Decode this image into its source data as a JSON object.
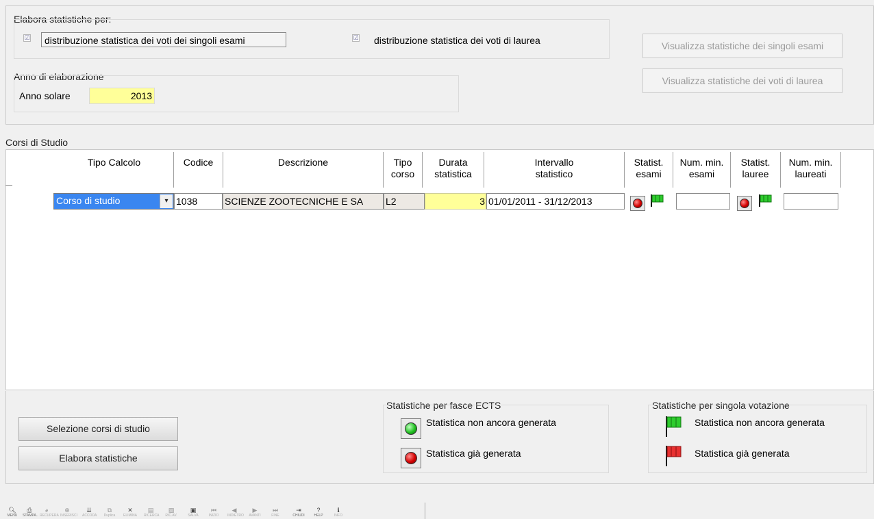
{
  "elabora": {
    "title": "Elabora statistiche per:",
    "check_exams_label": "distribuzione statistica dei voti dei singoli esami",
    "check_degree_label": "distribuzione statistica dei voti di laurea",
    "check_mark": "☑"
  },
  "buttons": {
    "view_exams": "Visualizza statistiche dei singoli esami",
    "view_degree": "Visualizza statistiche dei voti di laurea",
    "select_courses": "Selezione corsi di studio",
    "run_stats": "Elabora statistiche"
  },
  "year": {
    "group_title": "Anno di elaborazione",
    "label": "Anno solare",
    "value": "2013"
  },
  "courses": {
    "section_title": "Corsi di Studio",
    "headers": {
      "tipo_calcolo": "Tipo Calcolo",
      "codice": "Codice",
      "descrizione": "Descrizione",
      "tipo_corso": [
        "Tipo",
        "corso"
      ],
      "durata": [
        "Durata",
        "statistica"
      ],
      "intervallo": [
        "Intervallo",
        "statistico"
      ],
      "stat_esami": [
        "Statist.",
        "esami"
      ],
      "num_min_esami": [
        "Num. min.",
        "esami"
      ],
      "stat_lauree": [
        "Statist.",
        "lauree"
      ],
      "num_min_laureati": [
        "Num. min.",
        "laureati"
      ]
    },
    "rows": [
      {
        "tipo_calcolo": "Corso di studio",
        "codice": "1038",
        "descrizione": "SCIENZE ZOOTECNICHE E SA",
        "tipo_corso": "L2",
        "durata": "3",
        "intervallo": "01/01/2011 - 31/12/2013",
        "num_min_esami": "",
        "num_min_laureati": ""
      }
    ]
  },
  "legend_ects": {
    "title": "Statistiche per fasce ECTS",
    "not_generated": "Statistica non ancora generata",
    "generated": "Statistica già generata"
  },
  "legend_vote": {
    "title": "Statistiche per singola votazione",
    "not_generated": "Statistica non ancora generata",
    "generated": "Statistica già generata"
  },
  "toolbar": {
    "items": [
      "MENU",
      "STAMPA..",
      "RECUPERA",
      "INSERISCI",
      "ACCODA",
      "Duplica",
      "ELIMINA",
      "RICERCA",
      "RIC.AV.",
      "SALVA",
      "INIZIO",
      "INDIETRO",
      "AVANTI",
      "FINE",
      "CHIUDI",
      "HELP",
      "INFO"
    ]
  },
  "colors": {
    "highlight_yellow": "#ffff99",
    "selection_blue": "#3a86f0",
    "flag_green": "#2ecc2e",
    "flag_red": "#e83030"
  }
}
